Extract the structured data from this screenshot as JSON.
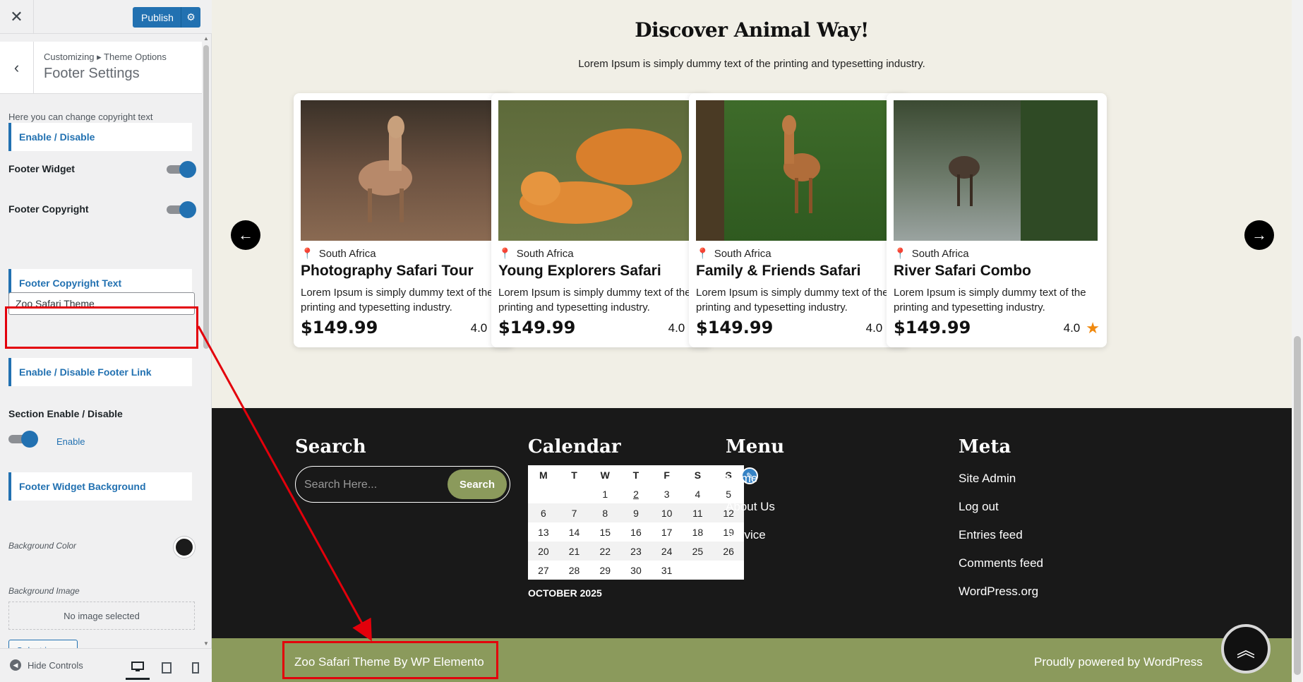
{
  "customizer": {
    "close_icon": "close-icon",
    "publish_label": "Publish",
    "breadcrumb": "Customizing ▸ Theme Options",
    "section_title": "Footer Settings",
    "description": "Here you can change copyright text",
    "enable_disable_heading": "Enable / Disable",
    "footer_widget_label": "Footer Widget",
    "footer_copyright_label": "Footer Copyright",
    "copyright_text_heading": "Footer Copyright Text",
    "copyright_text_value": "Zoo Safari Theme",
    "footer_link_heading": "Enable / Disable Footer Link",
    "section_enable_label": "Section Enable / Disable",
    "section_enable_state": "Enable",
    "widget_bg_heading": "Footer Widget Background",
    "bg_color_label": "Background Color",
    "bg_color_value": "#1b1b1b",
    "bg_image_label": "Background Image",
    "no_image_text": "No image selected",
    "select_image_label": "Select image",
    "hide_controls_label": "Hide Controls",
    "accent_color": "#2271b1"
  },
  "preview": {
    "section_title": "Discover Animal Way!",
    "section_subtitle": "Lorem Ipsum is simply dummy text of the printing and typesetting industry.",
    "cards": [
      {
        "location": "South Africa",
        "title": "Photography Safari Tour",
        "desc": "Lorem Ipsum is simply dummy text of the printing and typesetting industry.",
        "price": "$149.99",
        "rating": "4.0"
      },
      {
        "location": "South Africa",
        "title": "Young Explorers Safari",
        "desc": "Lorem Ipsum is simply dummy text of the printing and typesetting industry.",
        "price": "$149.99",
        "rating": "4.0"
      },
      {
        "location": "South Africa",
        "title": "Family & Friends Safari",
        "desc": "Lorem Ipsum is simply dummy text of the printing and typesetting industry.",
        "price": "$149.99",
        "rating": "4.0"
      },
      {
        "location": "South Africa",
        "title": "River Safari Combo",
        "desc": "Lorem Ipsum is simply dummy text of the printing and typesetting industry.",
        "price": "$149.99",
        "rating": "4.0"
      }
    ],
    "footer": {
      "search_title": "Search",
      "search_placeholder": "Search Here...",
      "search_button": "Search",
      "calendar_title": "Calendar",
      "calendar_days": [
        "M",
        "T",
        "W",
        "T",
        "F",
        "S",
        "S"
      ],
      "calendar_rows": [
        [
          "",
          "",
          "1",
          "2",
          "3",
          "4",
          "5"
        ],
        [
          "6",
          "7",
          "8",
          "9",
          "10",
          "11",
          "12"
        ],
        [
          "13",
          "14",
          "15",
          "16",
          "17",
          "18",
          "19"
        ],
        [
          "20",
          "21",
          "22",
          "23",
          "24",
          "25",
          "26"
        ],
        [
          "27",
          "28",
          "29",
          "30",
          "31",
          "",
          ""
        ]
      ],
      "calendar_caption": "OCTOBER 2025",
      "menu_title": "Menu",
      "menu_items": [
        "Home",
        "About Us",
        "Service"
      ],
      "meta_title": "Meta",
      "meta_items": [
        "Site Admin",
        "Log out",
        "Entries feed",
        "Comments feed",
        "WordPress.org"
      ],
      "copyright_left": "Zoo Safari Theme By WP Elemento",
      "copyright_right": "Proudly powered by WordPress",
      "footer_bg": "#191919",
      "copyright_bg": "#8b9a5c"
    }
  }
}
